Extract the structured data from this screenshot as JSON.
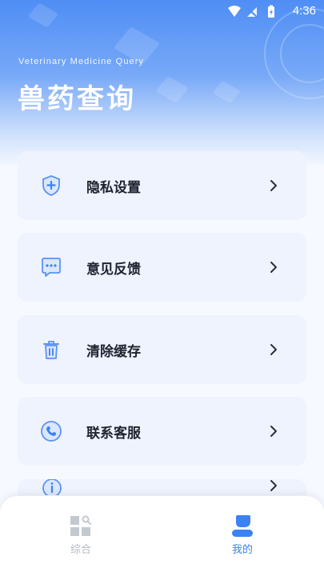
{
  "status_bar": {
    "time": "4:36"
  },
  "header": {
    "subtitle": "Veterinary Medicine Query",
    "title": "兽药查询"
  },
  "menu": {
    "items": [
      {
        "label": "隐私设置",
        "icon": "shield-plus-icon"
      },
      {
        "label": "意见反馈",
        "icon": "chat-bubble-icon"
      },
      {
        "label": "清除缓存",
        "icon": "trash-icon"
      },
      {
        "label": "联系客服",
        "icon": "phone-icon"
      }
    ],
    "partial_item_icon": "info-icon"
  },
  "bottom_nav": {
    "tabs": [
      {
        "label": "综合",
        "icon": "grid-search-icon",
        "active": false
      },
      {
        "label": "我的",
        "icon": "user-icon",
        "active": true
      }
    ]
  },
  "colors": {
    "accent": "#3b82f6",
    "card_bg": "#eef3fe",
    "text_dark": "#1e2330",
    "inactive": "#b5b9c2"
  }
}
